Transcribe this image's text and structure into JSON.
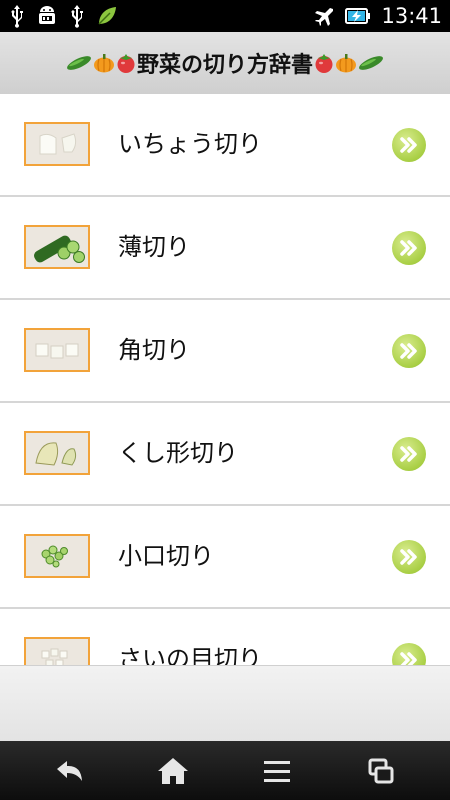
{
  "status_bar": {
    "time": "13:41",
    "left_icons": [
      "usb-icon",
      "android-debug-icon",
      "usb-icon",
      "leaf-notification-icon"
    ],
    "right_icons": [
      "airplane-mode-icon",
      "battery-charging-icon"
    ]
  },
  "header": {
    "title": "野菜の切り方辞書",
    "decor_left": [
      "cucumber-icon",
      "pumpkin-icon",
      "tomato-icon"
    ],
    "decor_right": [
      "tomato-icon",
      "pumpkin-icon",
      "cucumber-icon"
    ]
  },
  "list": {
    "items": [
      {
        "label": "いちょう切り",
        "thumb": "ginkgo-cut-thumbnail"
      },
      {
        "label": "薄切り",
        "thumb": "thin-slice-thumbnail"
      },
      {
        "label": "角切り",
        "thumb": "dice-cut-thumbnail"
      },
      {
        "label": "くし形切り",
        "thumb": "wedge-cut-thumbnail"
      },
      {
        "label": "小口切り",
        "thumb": "round-slice-thumbnail"
      },
      {
        "label": "さいの目切り",
        "thumb": "cube-cut-thumbnail"
      }
    ],
    "arrow_icon": "double-chevron-right-icon"
  },
  "nav_bar": {
    "buttons": [
      "back-icon",
      "home-icon",
      "menu-icon",
      "recent-apps-icon"
    ]
  },
  "colors": {
    "accent_green": "#a9cf45",
    "thumb_border": "#f2a33a",
    "status_bar": "#000000",
    "title_bar": "#d6d6d6"
  }
}
